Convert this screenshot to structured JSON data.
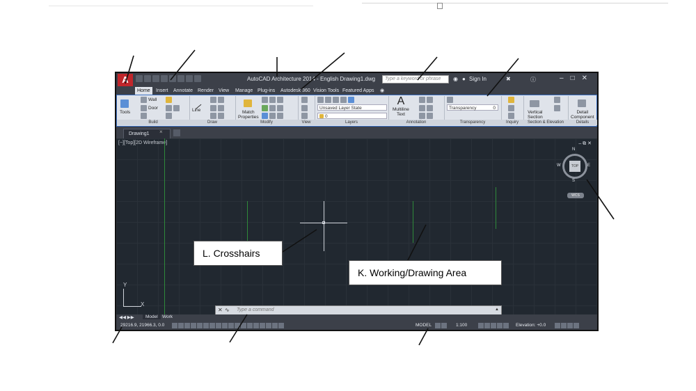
{
  "window": {
    "title": "AutoCAD Architecture 2014 - English    Drawing1.dwg",
    "search_placeholder": "Type a keyword or phrase",
    "sign_in": "Sign In",
    "app_button": "A"
  },
  "ribbon_tabs": [
    "Home",
    "Insert",
    "Annotate",
    "Render",
    "View",
    "Manage",
    "Plug-ins",
    "Autodesk 360",
    "Vision Tools",
    "Featured Apps"
  ],
  "ribbon": {
    "tools": "Tools",
    "wall": "Wall",
    "door": "Door",
    "build": "Build",
    "line": "Line",
    "draw": "Draw",
    "match_properties_1": "Match",
    "match_properties_2": "Properties",
    "modify": "Modify",
    "view": "View",
    "layer_state": "Unsaved Layer State",
    "layer_current": "0",
    "layers": "Layers",
    "multiline_1": "Multiline",
    "multiline_2": "Text",
    "annotation": "Annotation",
    "transparency_field": "Transparency",
    "transparency_value": "0",
    "transparency": "Transparency",
    "inquiry": "Inquiry",
    "vertical_1": "Vertical",
    "vertical_2": "Section",
    "section_elevation": "Section & Elevation",
    "detail_1": "Detail",
    "detail_2": "Component",
    "details": "Details"
  },
  "file_tab": "Drawing1",
  "viewport": {
    "label": "[−][Top][2D Wireframe]",
    "cube_top": "TOP",
    "n": "N",
    "s": "S",
    "e": "E",
    "w": "W",
    "wcs": "WCS"
  },
  "command_placeholder": "Type a command",
  "layout_tabs": [
    "Model",
    "Work"
  ],
  "status": {
    "coords": "29216.9, 21966.3, 0.0",
    "model": "MODEL",
    "scale": "1:100",
    "elevation": "Elevation: +0.0"
  },
  "callouts": {
    "crosshairs": "L. Crosshairs",
    "drawing_area": "K. Working/Drawing Area"
  }
}
